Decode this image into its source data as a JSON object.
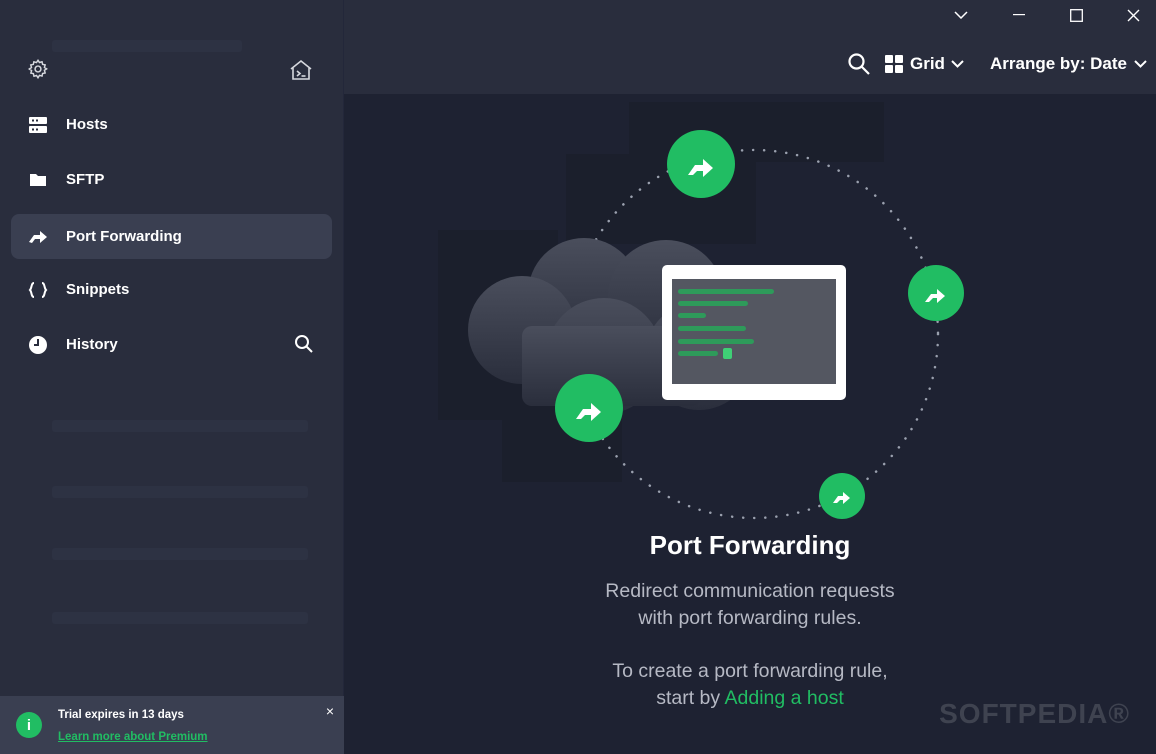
{
  "sidebar": {
    "items": [
      {
        "label": "Hosts",
        "icon": "server-icon"
      },
      {
        "label": "SFTP",
        "icon": "folder-icon"
      },
      {
        "label": "Port Forwarding",
        "icon": "forward-arrow-icon"
      },
      {
        "label": "Snippets",
        "icon": "braces-icon"
      },
      {
        "label": "History",
        "icon": "clock-icon"
      }
    ],
    "active_index": 2
  },
  "trial": {
    "icon_glyph": "i",
    "text": "Trial expires in 13 days",
    "link": "Learn more about Premium",
    "close_glyph": "×"
  },
  "header": {
    "view_label": "Grid",
    "arrange_label": "Arrange by: Date"
  },
  "main": {
    "title": "Port Forwarding",
    "desc_line1": "Redirect communication requests",
    "desc_line2": "with port forwarding rules.",
    "cta_line1": "To create a port forwarding rule,",
    "cta_prefix": "start by ",
    "cta_link": "Adding a host"
  },
  "watermark": "SOFTPEDIA®",
  "colors": {
    "accent": "#21bd63",
    "sidebar_bg": "#292d3d",
    "main_bg": "#1e2232",
    "active_item_bg": "#3a3f51"
  }
}
